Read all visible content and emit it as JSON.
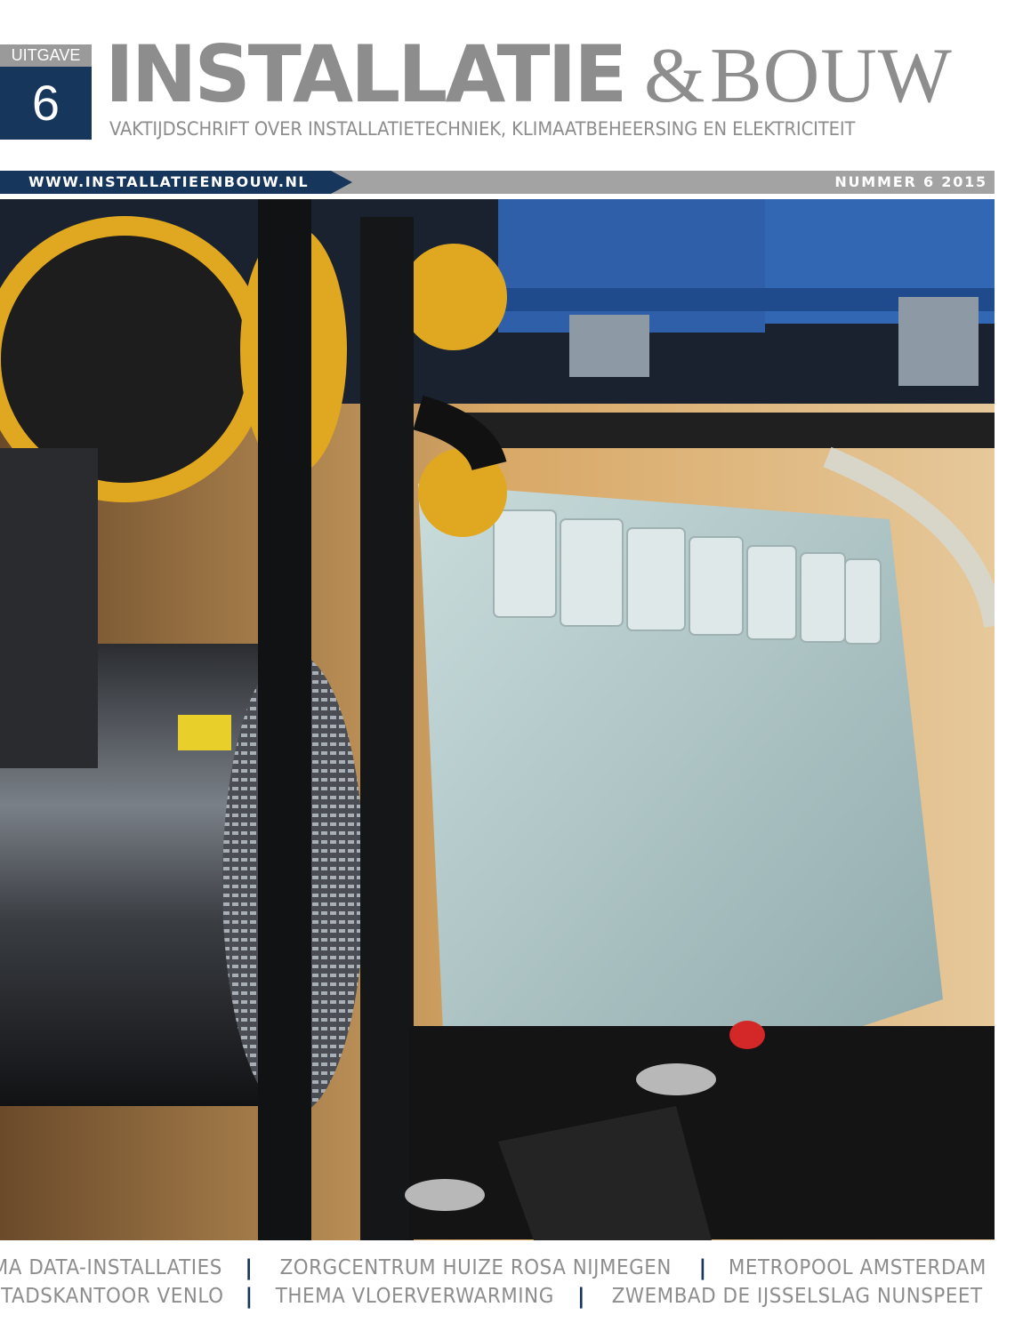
{
  "issue": {
    "label": "UITGAVE",
    "number": "6"
  },
  "masthead": {
    "title_main": "INSTALLATIE",
    "title_amp": "&",
    "title_secondary": "BOUW",
    "subtitle": "VAKTIJDSCHRIFT OVER INSTALLATIETECHNIEK, KLIMAATBEHEERSING EN ELEKTRICITEIT"
  },
  "strip": {
    "url": "WWW.INSTALLATIEENBOUW.NL",
    "edition": "NUMMER 6 2015"
  },
  "topics": {
    "row1": [
      "THEMA DATA-INSTALLATIES",
      "ZORGCENTRUM HUIZE ROSA NIJMEGEN",
      "METROPOOL AMSTERDAM"
    ],
    "row2": [
      "STADSKANTOOR VENLO",
      "THEMA VLOERVERWARMING",
      "ZWEMBAD DE IJSSELSLAG NUNSPEET"
    ],
    "separator": "|"
  },
  "colors": {
    "brand_navy": "#17365c",
    "masthead_grey": "#8d8d8d",
    "strip_grey": "#a3a3a3"
  }
}
